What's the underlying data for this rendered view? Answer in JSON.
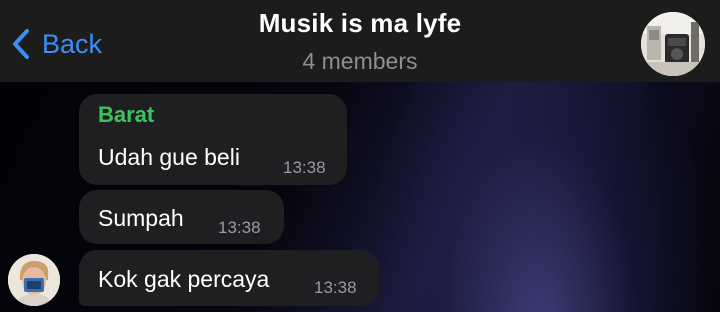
{
  "header": {
    "back_label": "Back",
    "title": "Musik is ma lyfe",
    "subtitle": "4 members"
  },
  "messages": [
    {
      "sender": "Barat",
      "text": "Udah gue beli",
      "time": "13:38"
    },
    {
      "sender": "",
      "text": "Sumpah",
      "time": "13:38"
    },
    {
      "sender": "",
      "text": "Kok gak percaya",
      "time": "13:38"
    }
  ],
  "colors": {
    "accent": "#3a8ef6",
    "sender_name": "#3ec25e",
    "bubble": "#1f1f21",
    "header_bg": "#1c1c1d"
  },
  "icons": {
    "back": "chevron-left-icon"
  }
}
